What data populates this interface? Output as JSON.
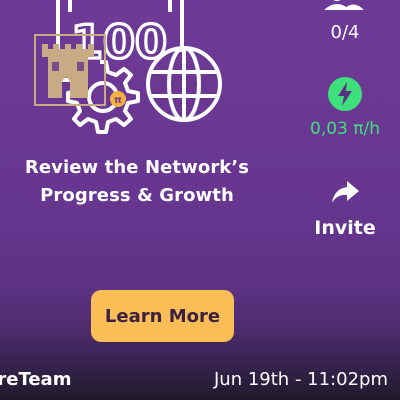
{
  "card": {
    "badge_number": "100",
    "headline_line1": "Review the Network’s",
    "headline_line2": "Progress & Growth",
    "cta_label": "Learn More"
  },
  "side_panel": {
    "peers_count": "0/4",
    "mining_rate": "0,03 π/h",
    "invite_label": "Invite"
  },
  "footer": {
    "author": "PiCoreTeam",
    "author_visible": "oreTeam",
    "timestamp": "Jun 19th - 11:02pm"
  },
  "colors": {
    "background": "#6b3a92",
    "cta": "#fbbd55",
    "rate_green": "#3ee07b",
    "overlay_logo": "#c8aa85"
  },
  "icons": [
    "certificate-icon",
    "gear-icon",
    "globe-icon",
    "pi-coin-icon",
    "castle-logo-icon",
    "peers-icon",
    "lightning-icon",
    "share-arrow-icon"
  ]
}
